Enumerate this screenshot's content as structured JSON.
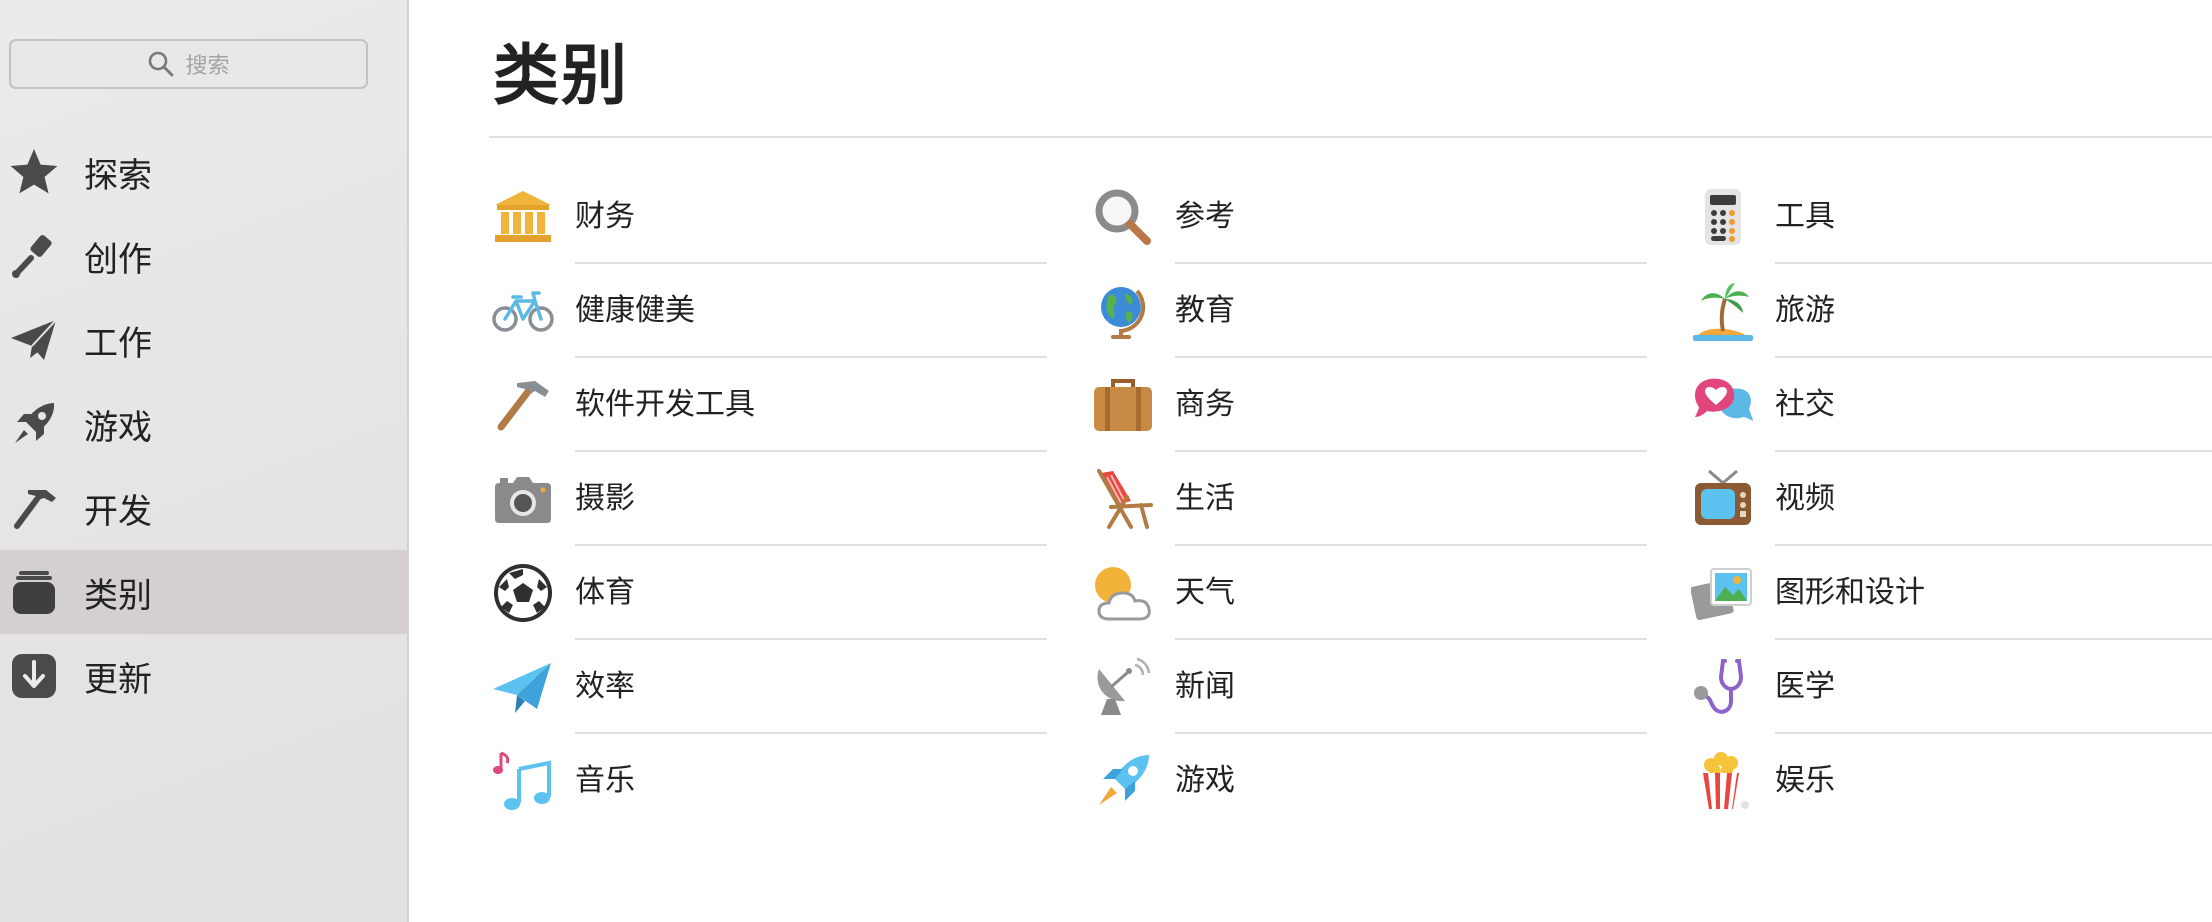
{
  "sidebar": {
    "search_placeholder": "搜索",
    "items": [
      {
        "label": "探索",
        "icon": "star-icon"
      },
      {
        "label": "创作",
        "icon": "paintbrush-icon"
      },
      {
        "label": "工作",
        "icon": "paper-plane-icon"
      },
      {
        "label": "游戏",
        "icon": "rocket-icon"
      },
      {
        "label": "开发",
        "icon": "hammer-icon"
      },
      {
        "label": "类别",
        "icon": "stack-icon",
        "selected": true
      },
      {
        "label": "更新",
        "icon": "download-icon"
      }
    ]
  },
  "main": {
    "title": "类别",
    "categories": [
      {
        "label": "财务",
        "icon": "bank-icon"
      },
      {
        "label": "参考",
        "icon": "magnifier-icon"
      },
      {
        "label": "工具",
        "icon": "calculator-icon"
      },
      {
        "label": "健康健美",
        "icon": "bicycle-icon"
      },
      {
        "label": "教育",
        "icon": "globe-icon"
      },
      {
        "label": "旅游",
        "icon": "palm-tree-icon"
      },
      {
        "label": "软件开发工具",
        "icon": "hammer-icon"
      },
      {
        "label": "商务",
        "icon": "briefcase-icon"
      },
      {
        "label": "社交",
        "icon": "chat-bubbles-icon"
      },
      {
        "label": "摄影",
        "icon": "camera-icon"
      },
      {
        "label": "生活",
        "icon": "beach-chair-icon"
      },
      {
        "label": "视频",
        "icon": "television-icon"
      },
      {
        "label": "体育",
        "icon": "soccer-ball-icon"
      },
      {
        "label": "天气",
        "icon": "sun-cloud-icon"
      },
      {
        "label": "图形和设计",
        "icon": "photos-icon"
      },
      {
        "label": "效率",
        "icon": "paper-plane-icon"
      },
      {
        "label": "新闻",
        "icon": "satellite-dish-icon"
      },
      {
        "label": "医学",
        "icon": "stethoscope-icon"
      },
      {
        "label": "音乐",
        "icon": "music-notes-icon"
      },
      {
        "label": "游戏",
        "icon": "rocket-icon"
      },
      {
        "label": "娱乐",
        "icon": "popcorn-icon"
      }
    ]
  }
}
